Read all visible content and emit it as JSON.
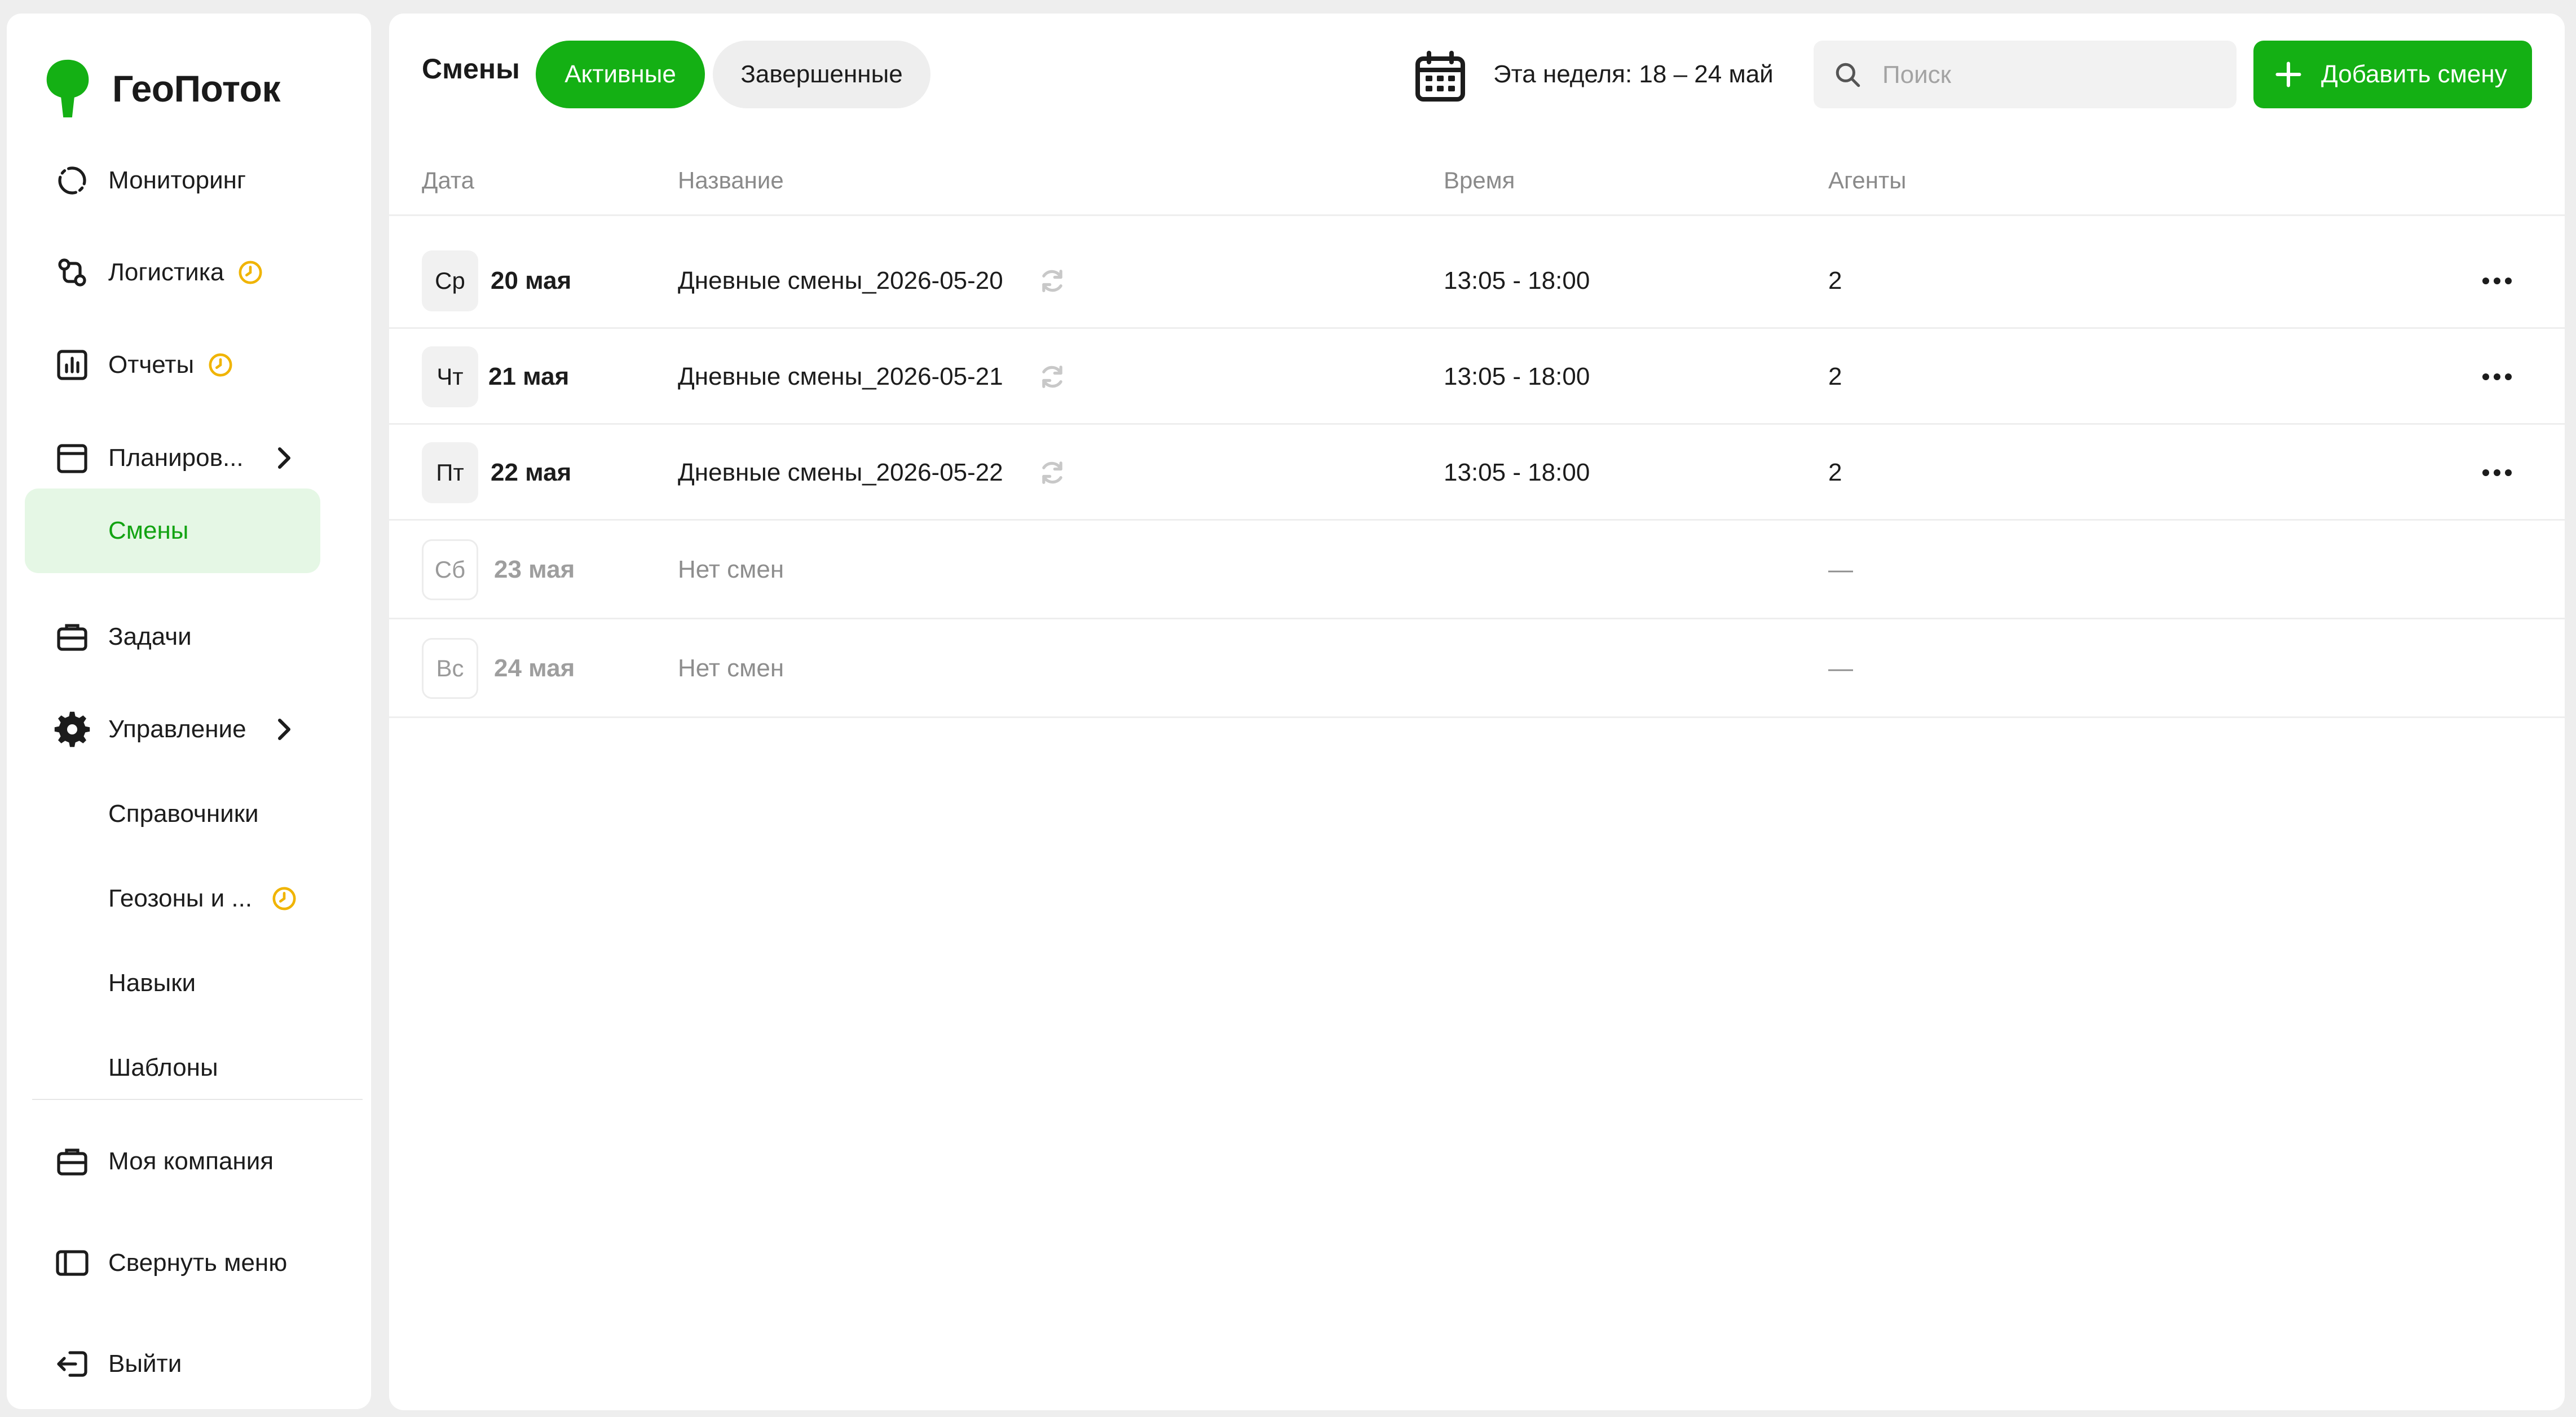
{
  "app": {
    "name": "ГеоПоток",
    "brand_color": "#14b014"
  },
  "sidebar": {
    "items": [
      {
        "label": "Мониторинг",
        "icon": "monitoring-icon"
      },
      {
        "label": "Логистика",
        "icon": "logistics-icon",
        "badge": "pending-clock-icon"
      },
      {
        "label": "Отчеты",
        "icon": "reports-icon",
        "badge": "pending-clock-icon"
      },
      {
        "label": "Планиров...",
        "icon": "calendar-icon",
        "expandable": true
      },
      {
        "label": "Смены",
        "active": true
      },
      {
        "label": "Задачи",
        "icon": "briefcase-icon"
      },
      {
        "label": "Управление",
        "icon": "gear-icon",
        "expandable": true
      },
      {
        "label": "Справочники"
      },
      {
        "label": "Геозоны и ...",
        "badge": "pending-clock-icon"
      },
      {
        "label": "Навыки"
      },
      {
        "label": "Шаблоны"
      },
      {
        "label": "Моя компания",
        "icon": "briefcase-icon"
      },
      {
        "label": "Свернуть меню",
        "icon": "collapse-menu-icon"
      },
      {
        "label": "Выйти",
        "icon": "logout-icon"
      }
    ]
  },
  "header": {
    "title": "Смены",
    "tabs": [
      {
        "label": "Активные",
        "selected": true
      },
      {
        "label": "Завершенные",
        "selected": false
      }
    ],
    "week_label": "Эта неделя: 18 – 24 май",
    "search_placeholder": "Поиск",
    "add_button": "Добавить смену"
  },
  "table": {
    "columns": [
      "Дата",
      "Название",
      "Время",
      "Агенты"
    ],
    "rows": [
      {
        "weekday": "Ср",
        "date": "20 мая",
        "name": "Дневные смены_2026-05-20",
        "time": "13:05 - 18:00",
        "agents": "2",
        "has_shift": true
      },
      {
        "weekday": "Чт",
        "date": "21 мая",
        "name": "Дневные смены_2026-05-21",
        "time": "13:05 - 18:00",
        "agents": "2",
        "has_shift": true
      },
      {
        "weekday": "Пт",
        "date": "22 мая",
        "name": "Дневные смены_2026-05-22",
        "time": "13:05 - 18:00",
        "agents": "2",
        "has_shift": true
      },
      {
        "weekday": "Сб",
        "date": "23 мая",
        "name": "Нет смен",
        "time": "",
        "agents": "—",
        "has_shift": false
      },
      {
        "weekday": "Вс",
        "date": "24 мая",
        "name": "Нет смен",
        "time": "",
        "agents": "—",
        "has_shift": false
      }
    ]
  }
}
